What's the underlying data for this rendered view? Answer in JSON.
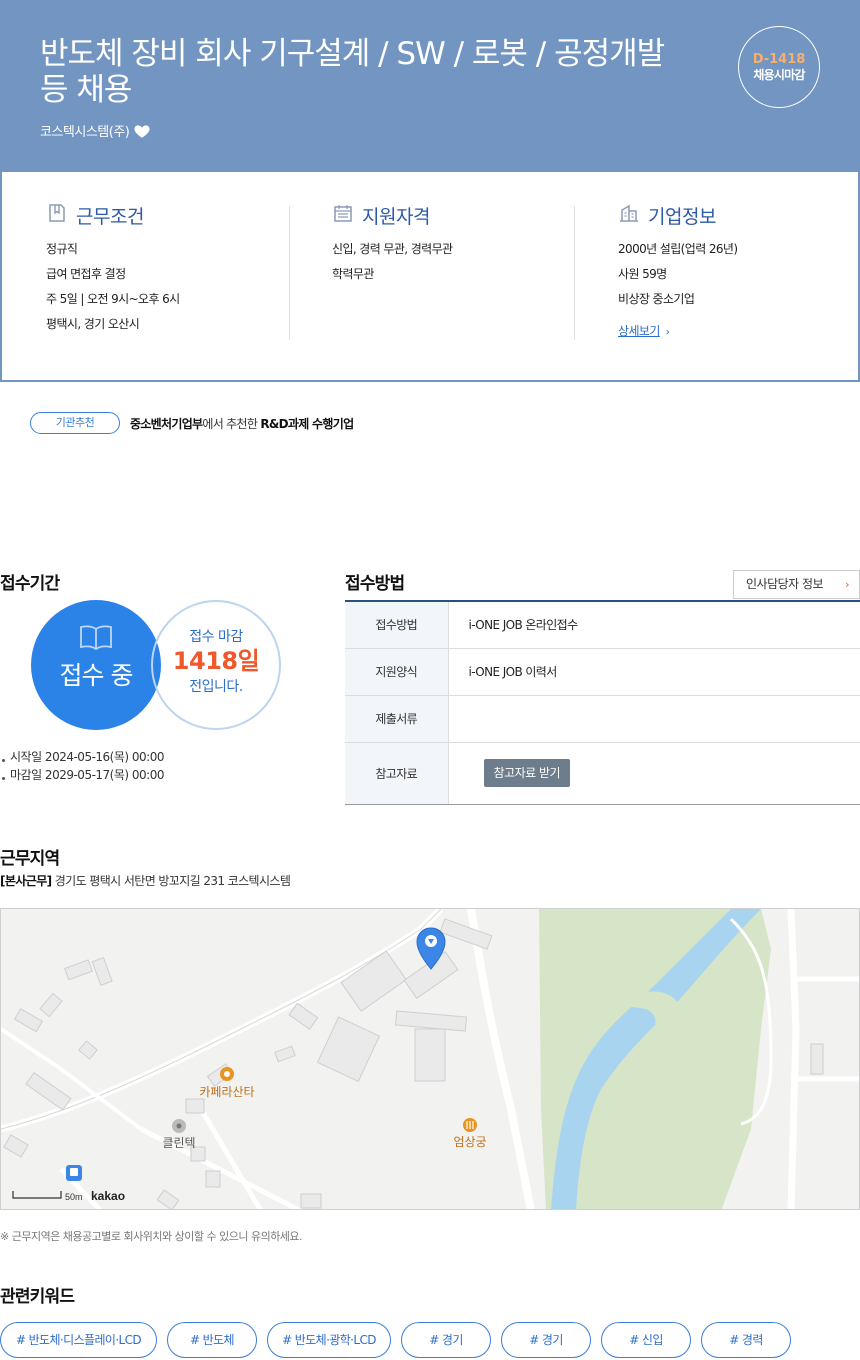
{
  "header": {
    "title": "반도체 장비 회사 기구설계 / SW / 로봇 / 공정개발 등 채용",
    "company": "코스텍시스템(주)",
    "dday": "D-1418",
    "dday_sub": "채용시마감"
  },
  "info": {
    "work": {
      "title": "근무조건",
      "items": [
        "정규직",
        "급여 면접후 결정",
        "주 5일 | 오전 9시~오후 6시",
        "평택시, 경기 오산시"
      ]
    },
    "qual": {
      "title": "지원자격",
      "items": [
        "신입, 경력 무관, 경력무관",
        "학력무관"
      ]
    },
    "corp": {
      "title": "기업정보",
      "items": [
        "2000년 설립(업력 26년)",
        "사원 59명",
        "비상장 중소기업"
      ],
      "more": "상세보기"
    }
  },
  "recommend": {
    "badge": "기관추천",
    "org": "중소벤처기업부",
    "mid": "에서 추천한 ",
    "target": "R&D과제 수행기업"
  },
  "period": {
    "title": "접수기간",
    "status": "접수 중",
    "line1": "접수 마감",
    "days": "1418일",
    "line3": "전입니다.",
    "start": "시작일 2024-05-16(목) 00:00",
    "end": "마감일 2029-05-17(목) 00:00"
  },
  "method": {
    "title": "접수방법",
    "hr_button": "인사담당자 정보",
    "rows": [
      {
        "k": "접수방법",
        "v": "i-ONE JOB 온라인접수"
      },
      {
        "k": "지원양식",
        "v": "i-ONE JOB 이력서"
      },
      {
        "k": "제출서류",
        "v": ""
      },
      {
        "k": "참고자료",
        "v": ""
      }
    ],
    "ref_button": "참고자료 받기"
  },
  "location": {
    "title": "근무지역",
    "tag": "[본사근무]",
    "address": " 경기도 평택시 서탄면 방꼬지길 231 코스텍시스템",
    "map": {
      "poi1": "카페라산타",
      "poi2": "클린텍",
      "poi3": "엄상궁",
      "scale": "50m",
      "brand": "kakao"
    },
    "note": "※ 근무지역은 채용공고별로 회사위치와 상이할 수 있으니 유의하세요."
  },
  "keywords": {
    "title": "관련키워드",
    "items": [
      "# 반도체·디스플레이·LCD",
      "# 반도체",
      "# 반도체·광학·LCD",
      "# 경기",
      "# 경기",
      "# 신입",
      "# 경력"
    ]
  },
  "colors": {
    "header_bg": "#7395c2",
    "accent_blue": "#2b83e8",
    "accent_orange": "#f0582b"
  }
}
